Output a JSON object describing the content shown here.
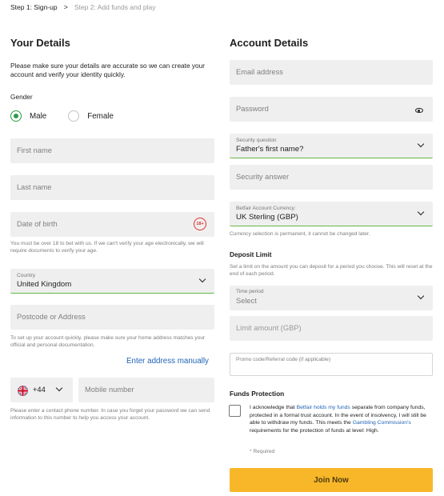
{
  "steps": {
    "step1": "Step 1: Sign-up",
    "arrow": ">",
    "step2": "Step 2: Add funds and play"
  },
  "your_details": {
    "title": "Your Details",
    "intro": "Please make sure your details are accurate so we can create your account and verify your identity quickly.",
    "gender_label": "Gender",
    "gender_options": [
      "Male",
      "Female"
    ],
    "gender_selected": "Male",
    "first_name_placeholder": "First name",
    "last_name_placeholder": "Last name",
    "dob_placeholder": "Date of birth",
    "age_badge": "18+",
    "age_note": "You must be over 18 to bet with us. If we can't verify your age electronically, we will require documents to verify your age.",
    "country_label": "Country",
    "country_value": "United Kingdom",
    "postcode_placeholder": "Postcode or Address",
    "address_note": "To set up your account quickly, please make sure your home address matches your official and personal documentation.",
    "enter_manually": "Enter address manually",
    "phone_code": "+44",
    "mobile_placeholder": "Mobile number",
    "phone_note": "Please enter a contact phone number. In case you forget your password we can send information to this number to help you access your account."
  },
  "account_details": {
    "title": "Account Details",
    "email_placeholder": "Email address",
    "password_placeholder": "Password",
    "security_question_label": "Security question",
    "security_question_value": "Father's first name?",
    "security_answer_placeholder": "Security answer",
    "currency_label": "Betfair Account Currency:",
    "currency_value": "UK Sterling (GBP)",
    "currency_note": "Currency selection is permanent, it cannot be changed later.",
    "deposit_title": "Deposit Limit",
    "deposit_note": "Set a limit on the amount you can deposit for a period you choose. This will reset at the end of each period.",
    "time_period_label": "Time period",
    "time_period_value": "Select",
    "limit_placeholder": "Limit amount (GBP)",
    "promo_placeholder": "Promo code/Referral code (if applicable)",
    "funds_title": "Funds Protection",
    "funds_text_1": "I acknowledge that ",
    "funds_link_1": "Betfair holds my funds",
    "funds_text_2": " separate from company funds, protected in a formal trust account. In the event of insolvency, I will still be able to withdraw my funds. This meets the ",
    "funds_link_2": "Gambling Commission's",
    "funds_text_3": " requirements for the protection of funds at level: High.",
    "required_note": "* Required",
    "join_button": "Join Now"
  },
  "colors": {
    "accent_green": "#2e9b4a",
    "underline_green": "#63b646",
    "link_blue": "#1f63b5",
    "join_yellow": "#f8b729",
    "age_red": "#e03131"
  },
  "icons": [
    "chevron-right-icon",
    "age-18-icon",
    "chevron-down-icon",
    "eye-icon",
    "uk-flag-icon"
  ]
}
